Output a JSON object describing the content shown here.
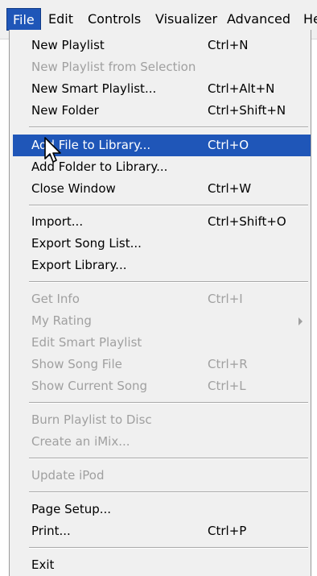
{
  "menubar": {
    "items": [
      {
        "label": "File"
      },
      {
        "label": "Edit"
      },
      {
        "label": "Controls"
      },
      {
        "label": "Visualizer"
      },
      {
        "label": "Advanced"
      },
      {
        "label": "He"
      }
    ]
  },
  "menu": {
    "items": [
      {
        "label": "New Playlist",
        "shortcut": "Ctrl+N"
      },
      {
        "label": "New Playlist from Selection",
        "shortcut": ""
      },
      {
        "label": "New Smart Playlist...",
        "shortcut": "Ctrl+Alt+N"
      },
      {
        "label": "New Folder",
        "shortcut": "Ctrl+Shift+N"
      },
      {
        "label": "Add File to Library...",
        "shortcut": "Ctrl+O"
      },
      {
        "label": "Add Folder to Library...",
        "shortcut": ""
      },
      {
        "label": "Close Window",
        "shortcut": "Ctrl+W"
      },
      {
        "label": "Import...",
        "shortcut": "Ctrl+Shift+O"
      },
      {
        "label": "Export Song List...",
        "shortcut": ""
      },
      {
        "label": "Export Library...",
        "shortcut": ""
      },
      {
        "label": "Get Info",
        "shortcut": "Ctrl+I"
      },
      {
        "label": "My Rating",
        "shortcut": ""
      },
      {
        "label": "Edit Smart Playlist",
        "shortcut": ""
      },
      {
        "label": "Show Song File",
        "shortcut": "Ctrl+R"
      },
      {
        "label": "Show Current Song",
        "shortcut": "Ctrl+L"
      },
      {
        "label": "Burn Playlist to Disc",
        "shortcut": ""
      },
      {
        "label": "Create an iMix...",
        "shortcut": ""
      },
      {
        "label": "Update iPod",
        "shortcut": ""
      },
      {
        "label": "Page Setup...",
        "shortcut": ""
      },
      {
        "label": "Print...",
        "shortcut": "Ctrl+P"
      },
      {
        "label": "Exit",
        "shortcut": ""
      }
    ]
  },
  "colors": {
    "highlight": "#1f56b8",
    "disabled_text": "#a0a0a0",
    "menu_bg": "#f0f0f0"
  }
}
